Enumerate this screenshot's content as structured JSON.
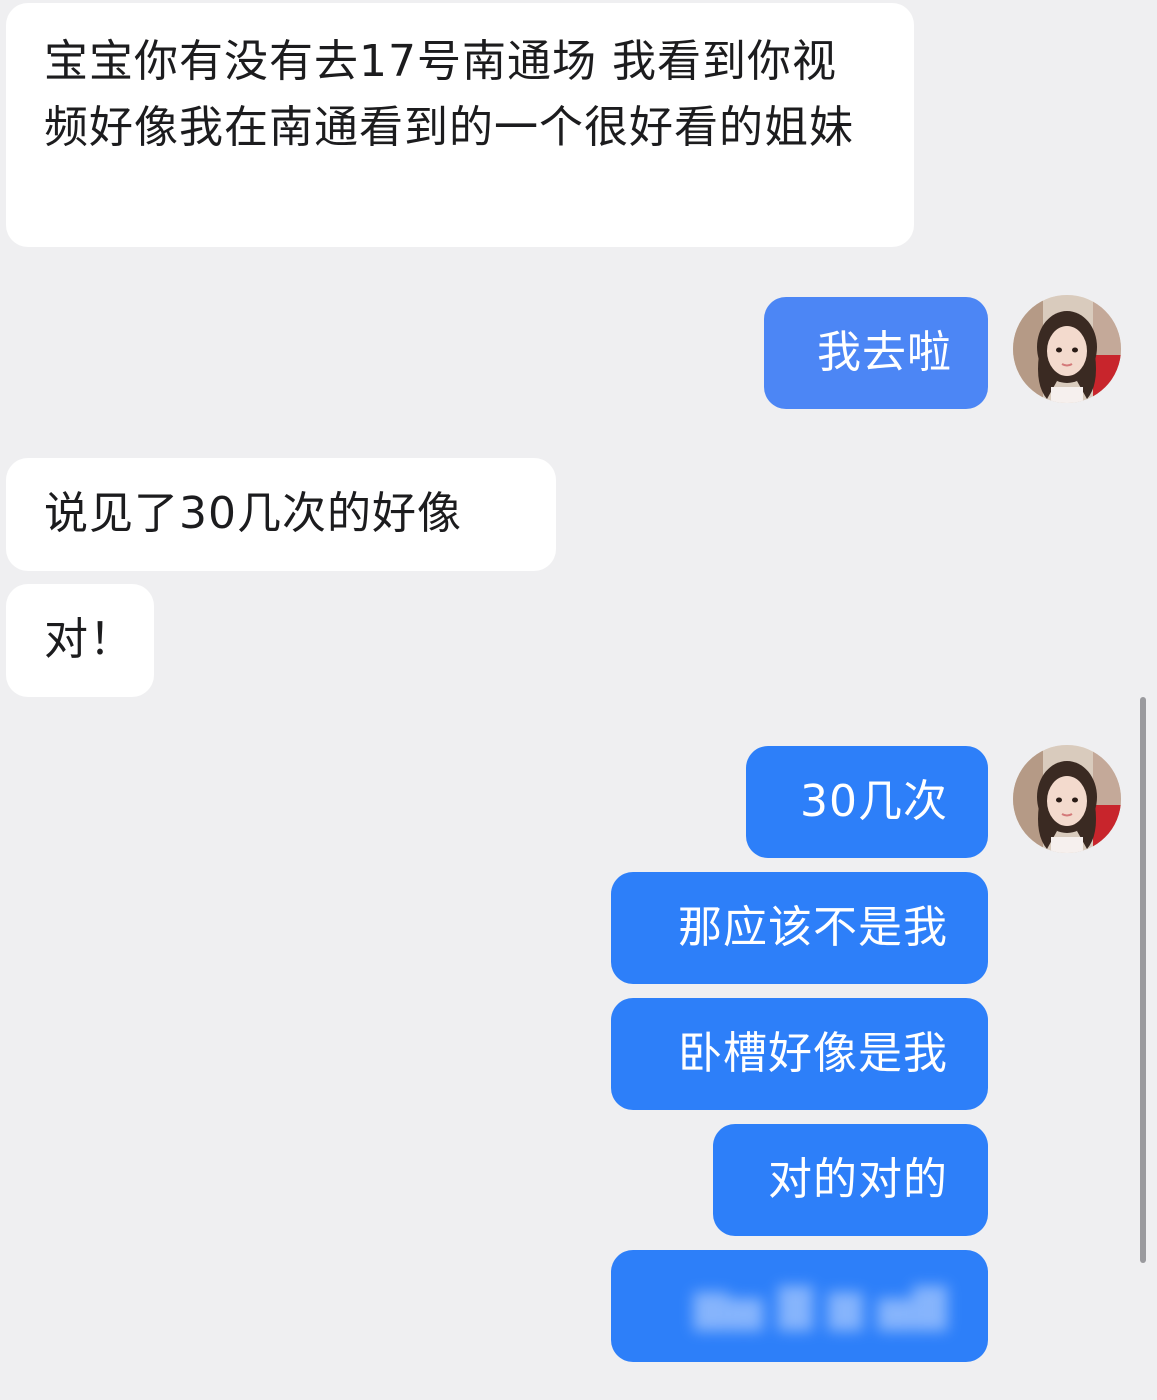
{
  "conversation": {
    "messages": [
      {
        "id": "msg-1",
        "sender": "other",
        "text": "宝宝你有没有去17号南通场 我看到你视频好像我在南通看到的一个很好看的姐妹"
      },
      {
        "id": "msg-2",
        "sender": "me",
        "text": "我去啦"
      },
      {
        "id": "msg-3",
        "sender": "other",
        "text": "说见了30几次的好像"
      },
      {
        "id": "msg-4",
        "sender": "other",
        "text": "对！"
      },
      {
        "id": "msg-5",
        "sender": "me",
        "text": "30几次"
      },
      {
        "id": "msg-6",
        "sender": "me",
        "text": "那应该不是我"
      },
      {
        "id": "msg-7",
        "sender": "me",
        "text": "卧槽好像是我"
      },
      {
        "id": "msg-8",
        "sender": "me",
        "text": "对的对的"
      },
      {
        "id": "msg-9",
        "sender": "me",
        "text": ""
      }
    ]
  },
  "colors": {
    "background": "#efeff1",
    "incoming_bubble": "#ffffff",
    "outgoing_bubble_light": "#4c86f5",
    "outgoing_bubble": "#2d7ff9",
    "text_dark": "#1c1c1e",
    "text_light": "#ffffff"
  },
  "icons": {
    "avatar": "user-avatar-icon"
  }
}
